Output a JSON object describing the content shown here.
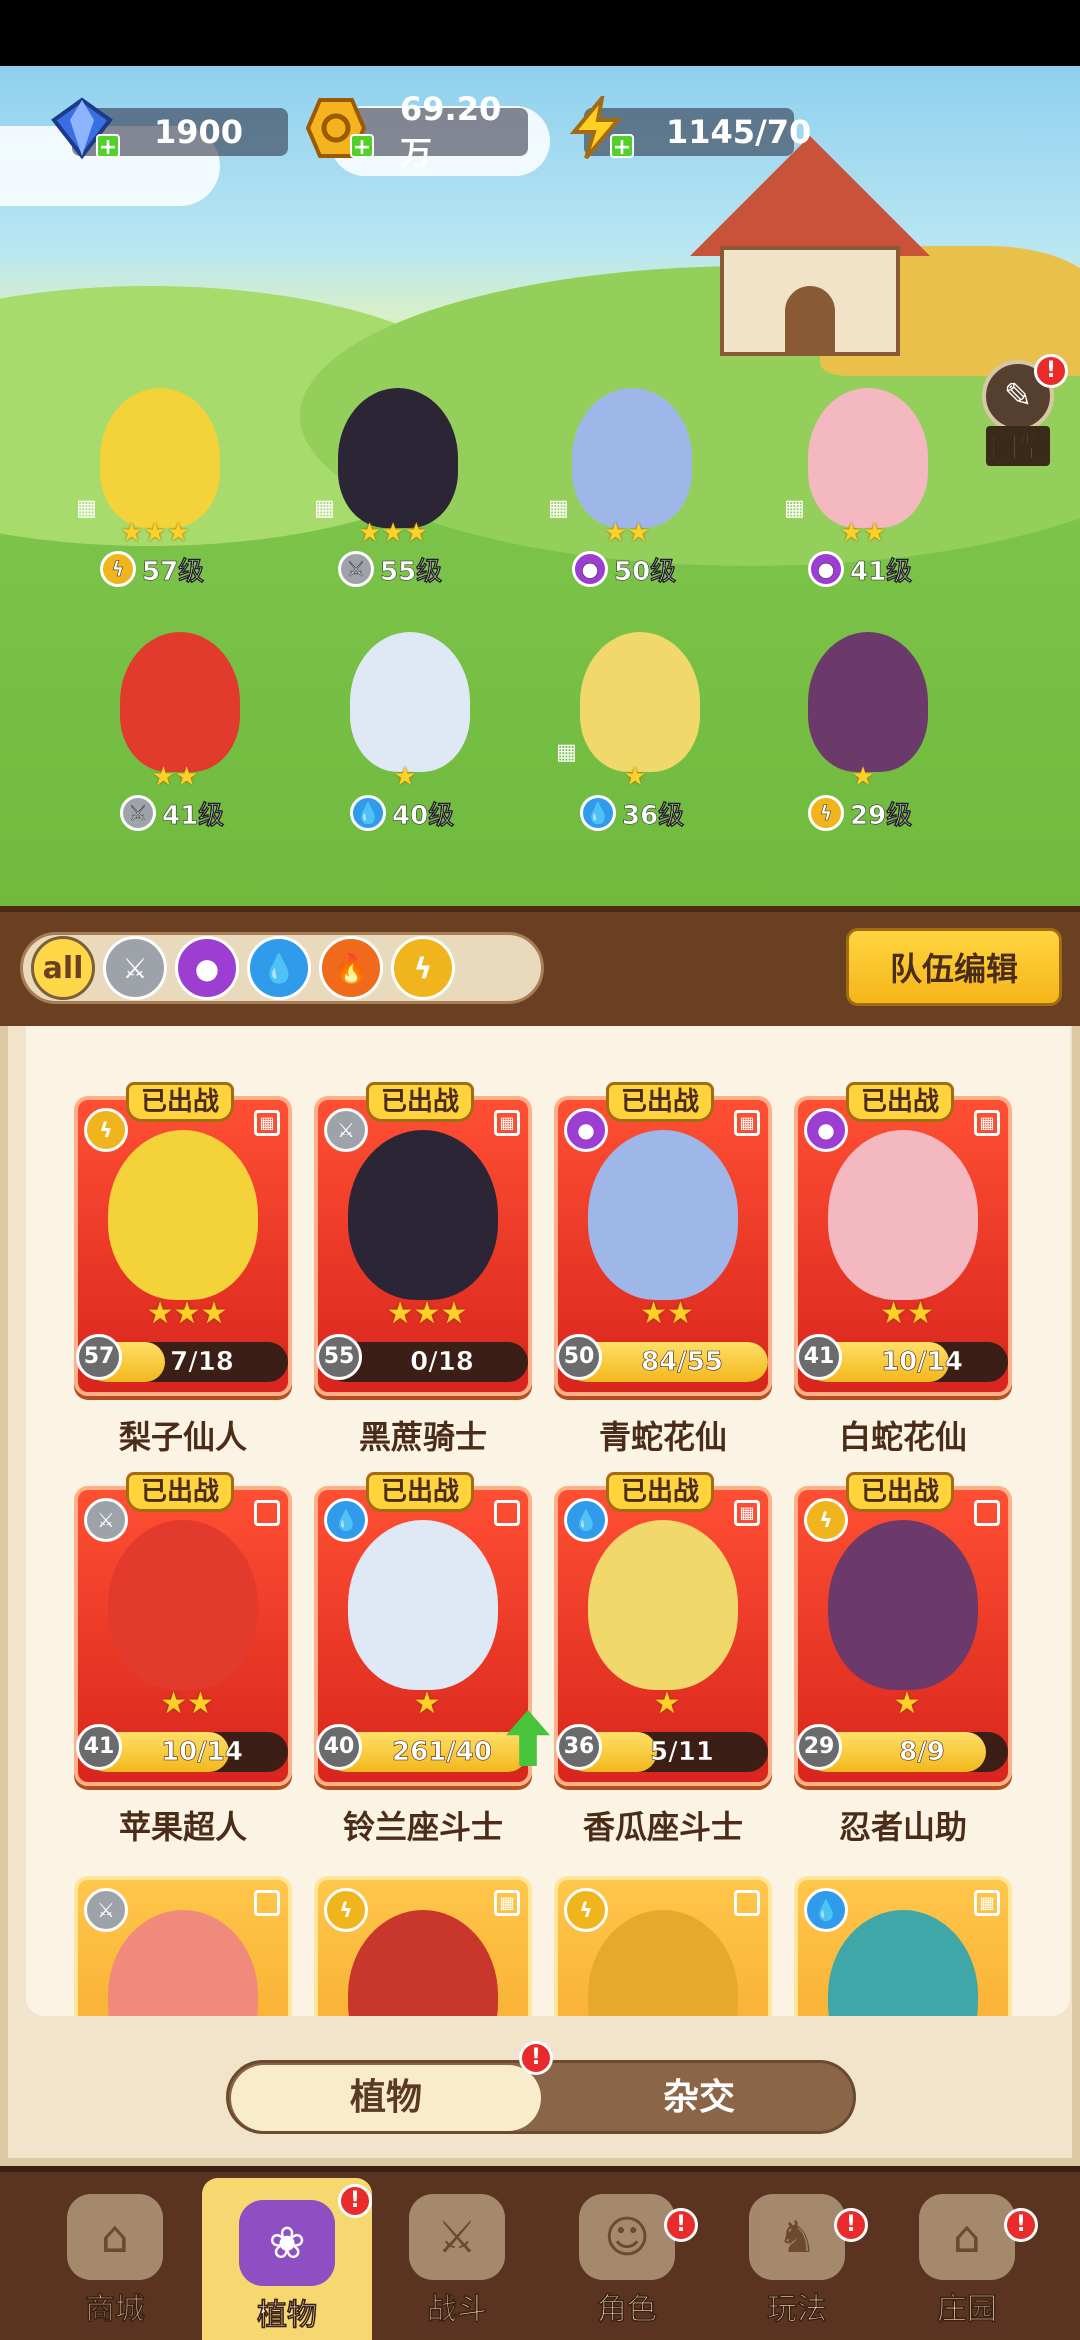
{
  "resources": [
    {
      "icon": "gem-icon",
      "value": "1900"
    },
    {
      "icon": "coin-icon",
      "value": "69.20万"
    },
    {
      "icon": "energy-icon",
      "value": "1145/70"
    }
  ],
  "codex": {
    "label": "图鉴"
  },
  "lineup": [
    {
      "level": "57级",
      "stars": "★★★",
      "element": "thunder"
    },
    {
      "level": "55级",
      "stars": "★★★",
      "element": "sword"
    },
    {
      "level": "50级",
      "stars": "★★",
      "element": "poison"
    },
    {
      "level": "41级",
      "stars": "★★",
      "element": "poison"
    },
    {
      "level": "41级",
      "stars": "★★",
      "element": "sword"
    },
    {
      "level": "40级",
      "stars": "★",
      "element": "water"
    },
    {
      "level": "36级",
      "stars": "★",
      "element": "water"
    },
    {
      "level": "29级",
      "stars": "★",
      "element": "thunder"
    }
  ],
  "filters": {
    "all_label": "all"
  },
  "team_edit_label": "队伍编辑",
  "deployed_tag": "已出战",
  "cards": [
    {
      "name": "梨子仙人",
      "level": "57",
      "progress": "7/18",
      "fill": 0.39,
      "stars": "★★★",
      "element": "thunder"
    },
    {
      "name": "黑蔗骑士",
      "level": "55",
      "progress": "0/18",
      "fill": 0.0,
      "stars": "★★★",
      "element": "sword"
    },
    {
      "name": "青蛇花仙",
      "level": "50",
      "progress": "84/55",
      "fill": 1.0,
      "stars": "★★",
      "element": "poison"
    },
    {
      "name": "白蛇花仙",
      "level": "41",
      "progress": "10/14",
      "fill": 0.71,
      "stars": "★★",
      "element": "poison"
    },
    {
      "name": "苹果超人",
      "level": "41",
      "progress": "10/14",
      "fill": 0.71,
      "stars": "★★",
      "element": "sword"
    },
    {
      "name": "铃兰座斗士",
      "level": "40",
      "progress": "261/40",
      "fill": 1.0,
      "stars": "★",
      "element": "water"
    },
    {
      "name": "香瓜座斗士",
      "level": "36",
      "progress": "5/11",
      "fill": 0.45,
      "stars": "★",
      "element": "water"
    },
    {
      "name": "忍者山助",
      "level": "29",
      "progress": "8/9",
      "fill": 0.89,
      "stars": "★",
      "element": "thunder"
    }
  ],
  "toggle": {
    "left": "植物",
    "right": "杂交"
  },
  "nav": [
    {
      "label": "商城"
    },
    {
      "label": "植物"
    },
    {
      "label": "战斗"
    },
    {
      "label": "角色"
    },
    {
      "label": "玩法"
    },
    {
      "label": "庄园"
    }
  ],
  "colors": {
    "card_red": "#d8251d",
    "card_gold": "#f39d20",
    "accent_yellow": "#ffd33c"
  }
}
